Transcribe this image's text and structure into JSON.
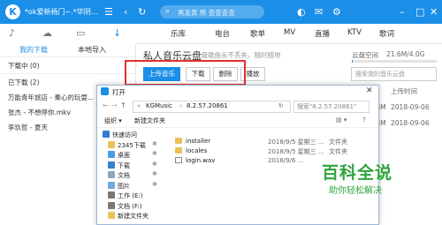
{
  "titlebar": {
    "title": "*ok爱新杨门~.*华阴...",
    "search_placeholder": "黑发黄 熊 查查查查"
  },
  "sidebar": {
    "tabs": [
      "我的下载",
      "本地导入"
    ],
    "sections": [
      {
        "label": "下载中 (0)"
      },
      {
        "label": "已下载 (2)"
      }
    ],
    "items": [
      "万能青年旅店 - 秦心的玩耍...",
      "张杰 - 不想停你.mkv",
      "李玖哲 - 夏天"
    ]
  },
  "nav": {
    "tabs": [
      "乐库",
      "电台",
      "歌单",
      "MV",
      "直播",
      "KTV",
      "歌词"
    ]
  },
  "cloud": {
    "title": "私人音乐云盘",
    "subtitle": "云盘歌曲永不丢失，随时随地",
    "space_label": "云盘空间",
    "space_value": "21.6M/4.0G",
    "space_used_fraction": 0.006,
    "buttons": {
      "upload": "上传音乐",
      "download": "下载",
      "delete": "删除",
      "play": "播放"
    },
    "search_placeholder": "搜索我的音乐云盘",
    "column_upload_time": "上传时间",
    "rows": [
      {
        "size": "BM",
        "date": "2018-09-06"
      },
      {
        "size": "BM",
        "date": "2018-09-06"
      }
    ]
  },
  "dialog": {
    "title": "打开",
    "close_label": "✕",
    "path": [
      "KGMusic",
      "8.2.57.20861"
    ],
    "search_placeholder": "搜索\"8.2.57.20861\"",
    "toolbar": {
      "organize": "组织 ▾",
      "new_folder": "新建文件夹"
    },
    "tree": [
      {
        "label": "快速访问",
        "icon": "star-icon",
        "color": "#2f7fd6",
        "pinned": false
      },
      {
        "label": "2345下载",
        "icon": "folder-icon",
        "color": "#e9c25a",
        "pinned": true
      },
      {
        "label": "桌面",
        "icon": "desktop-icon",
        "color": "#4a9be0",
        "pinned": true
      },
      {
        "label": "下载",
        "icon": "download-icon",
        "color": "#3b7fd0",
        "pinned": true
      },
      {
        "label": "文档",
        "icon": "document-icon",
        "color": "#8fa6c2",
        "pinned": true
      },
      {
        "label": "图片",
        "icon": "picture-icon",
        "color": "#6fa8dc",
        "pinned": true
      },
      {
        "label": "工作 (E:)",
        "icon": "drive-icon",
        "color": "#777777",
        "pinned": false
      },
      {
        "label": "文档 (F:)",
        "icon": "drive-icon",
        "color": "#777777",
        "pinned": false
      },
      {
        "label": "新建文件夹",
        "icon": "folder-icon",
        "color": "#e9c25a",
        "pinned": false
      }
    ],
    "files": [
      {
        "name": "installer",
        "date": "2018/9/5 星期三 ...",
        "type": "文件夹",
        "kind": "folder"
      },
      {
        "name": "locales",
        "date": "2018/9/5 星期三 ...",
        "type": "文件夹",
        "kind": "folder"
      },
      {
        "name": "login.wav",
        "date": "2018/9/6 ...",
        "type": "",
        "kind": "wav"
      }
    ]
  },
  "watermark": {
    "title": "百科全说",
    "subtitle": "助你轻松解决"
  },
  "colors": {
    "accent": "#1b8fe8",
    "highlight_frame": "#e53030",
    "watermark": "#2fa43d"
  }
}
